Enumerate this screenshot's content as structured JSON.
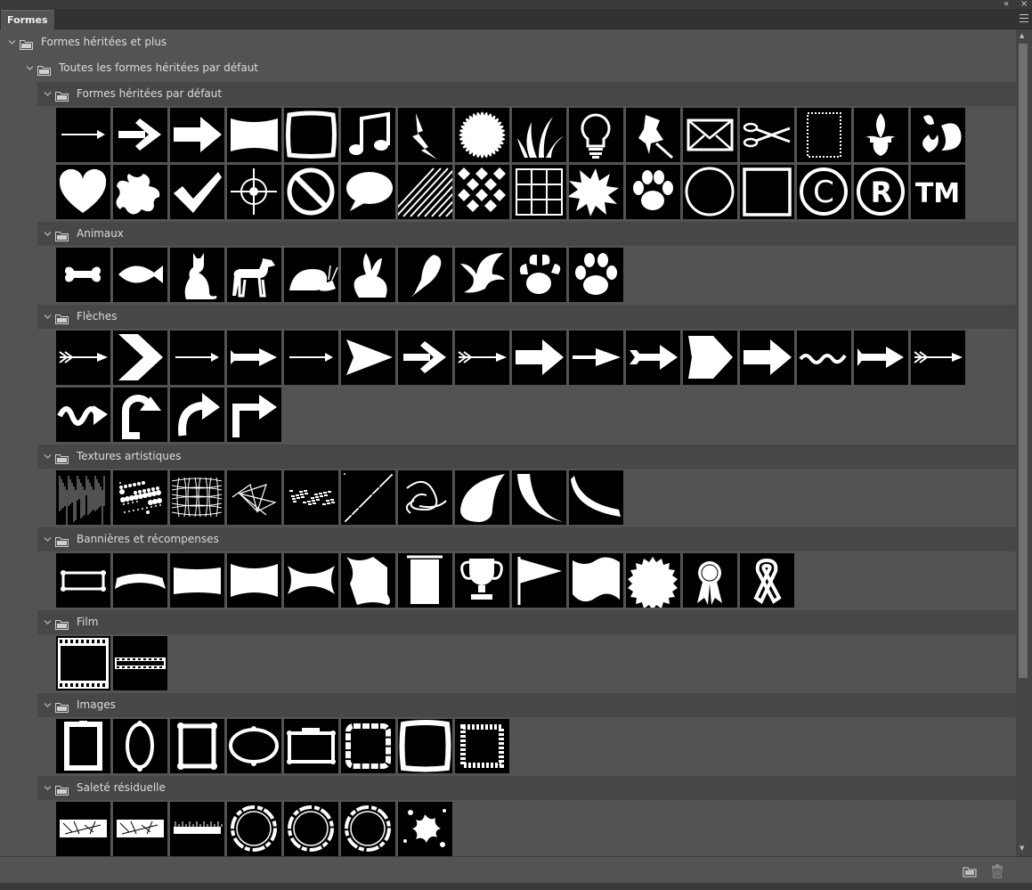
{
  "panel": {
    "tab_label": "Formes",
    "collapse_glyph": "«",
    "close_glyph": "×"
  },
  "tree": [
    {
      "label": "Formes héritées et plus",
      "level": 0
    },
    {
      "label": "Toutes les formes héritées par défaut",
      "level": 1
    },
    {
      "label": "Formes héritées par défaut",
      "level": 2,
      "count": 32
    },
    {
      "label": "Animaux",
      "level": 2,
      "count": 10
    },
    {
      "label": "Flèches",
      "level": 2,
      "count": 20
    },
    {
      "label": "Textures artistiques",
      "level": 2,
      "count": 10
    },
    {
      "label": "Bannières et récompenses",
      "level": 2,
      "count": 13
    },
    {
      "label": "Film",
      "level": 2,
      "count": 2
    },
    {
      "label": "Images",
      "level": 2,
      "count": 8
    },
    {
      "label": "Saleté résiduelle",
      "level": 2,
      "count": 7
    }
  ],
  "icons": {
    "Formes héritées par défaut": [
      "arrow-thin",
      "arrow-chevron",
      "arrow-bold",
      "banner",
      "square-frame",
      "music-note",
      "lightning",
      "flower",
      "grass",
      "light-bulb",
      "pushpin",
      "envelope",
      "scissors",
      "stamp",
      "fleur-de-lis",
      "ornament",
      "heart",
      "blob",
      "checkmark",
      "target",
      "no-sign",
      "speech-bubble",
      "diagonal-lines",
      "diamond-checker",
      "grid",
      "starburst",
      "paw-print",
      "circle-outline",
      "square-outline",
      "copyright",
      "registered",
      "trademark"
    ],
    "Animaux": [
      "bone",
      "fish",
      "cat",
      "dog",
      "snail",
      "rabbit",
      "parrot",
      "bird",
      "bear-paw",
      "cat-paw"
    ],
    "Flèches": [
      "arrow-fletched",
      "chevron-large",
      "arrow-thin",
      "arrow-bold-thin",
      "arrow-thin",
      "arrow-triangle",
      "arrow-chevron",
      "arrow-fletched",
      "arrow-block",
      "arrow-narrow",
      "arrow-notched",
      "arrow-pentagon",
      "arrow-bold",
      "arrow-wave",
      "arrow-double",
      "arrow-fletched",
      "arrow-squiggle",
      "arrow-u-turn",
      "arrow-curved",
      "arrow-corner"
    ],
    "Textures artistiques": [
      "texture-lines",
      "texture-splatter",
      "texture-crosshatch",
      "texture-scribble",
      "texture-wave",
      "texture-dots",
      "texture-swirl",
      "texture-crescent",
      "texture-horn",
      "texture-blade"
    ],
    "Bannières et récompenses": [
      "banner-scroll",
      "banner-ribbon",
      "banner-rect",
      "banner-concave",
      "banner-bow",
      "banner-wave",
      "banner-hanging",
      "trophy",
      "flag",
      "flag-wave",
      "seal",
      "rosette",
      "ribbon"
    ],
    "Film": [
      "film-frame",
      "film-strip"
    ],
    "Images": [
      "frame-tall",
      "frame-oval",
      "frame-ornate",
      "frame-oval-wide",
      "frame-ornate-wide",
      "frame-scalloped",
      "frame-rough",
      "frame-zigzag"
    ],
    "Saleté résiduelle": [
      "grunge-bar",
      "grunge-bar",
      "grunge-ruler",
      "grunge-ring",
      "grunge-ring",
      "grunge-ring",
      "grunge-splatter"
    ]
  },
  "footer": {
    "new_group_icon": "folder-icon",
    "delete_icon": "trash-icon"
  }
}
